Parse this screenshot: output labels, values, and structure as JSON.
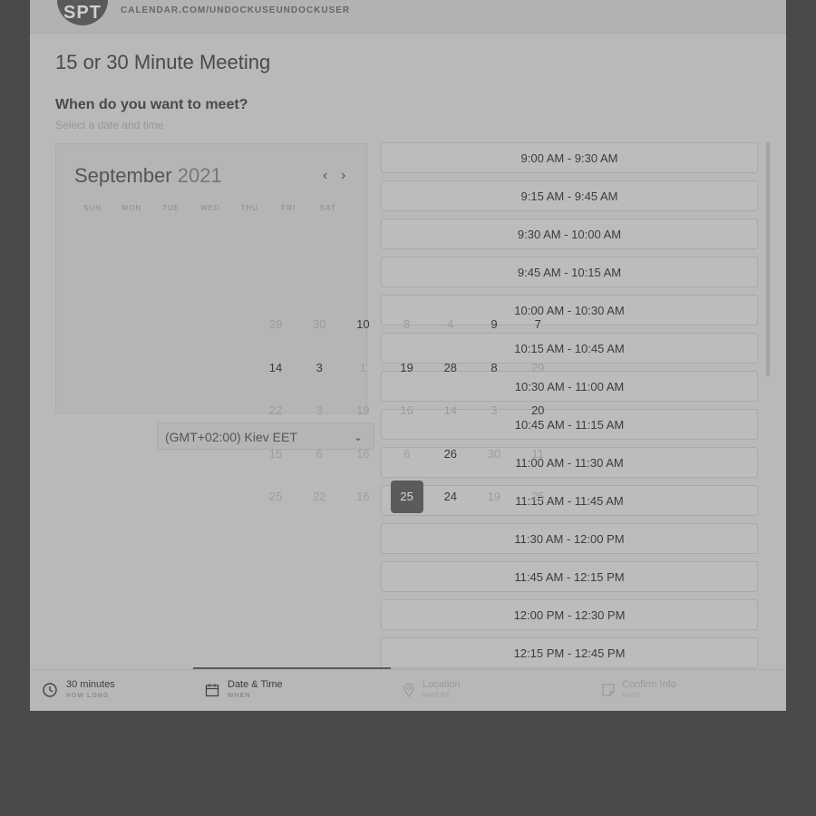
{
  "header": {
    "avatar_initials": "SPT",
    "url": "CALENDAR.COM/UNDOCKUSEUNDOCKUSER"
  },
  "meeting_title": "15 or 30 Minute Meeting",
  "prompt": {
    "title": "When do you want to meet?",
    "hint": "Select a date and time"
  },
  "calendar": {
    "month": "September",
    "year": "2021",
    "prev_icon": "‹",
    "next_icon": "›",
    "weekdays": [
      "SUN",
      "MON",
      "TUE",
      "WED",
      "THU",
      "FRI",
      "SAT"
    ],
    "selected_date": "25",
    "day_cells": [
      {
        "label": "29",
        "faint": true
      },
      {
        "label": "30",
        "faint": true
      },
      {
        "label": "10",
        "faint": false
      },
      {
        "label": "8",
        "faint": true
      },
      {
        "label": "4",
        "faint": true
      },
      {
        "label": "9",
        "faint": false
      },
      {
        "label": "7",
        "faint": false
      },
      {
        "label": "14",
        "faint": false
      },
      {
        "label": "3",
        "faint": false
      },
      {
        "label": "1",
        "faint": true
      },
      {
        "label": "19",
        "faint": false
      },
      {
        "label": "28",
        "faint": false
      },
      {
        "label": "8",
        "faint": false
      },
      {
        "label": "29",
        "faint": true
      },
      {
        "label": "22",
        "faint": true
      },
      {
        "label": "3",
        "faint": true
      },
      {
        "label": "19",
        "faint": true
      },
      {
        "label": "16",
        "faint": true
      },
      {
        "label": "14",
        "faint": true
      },
      {
        "label": "3",
        "faint": true
      },
      {
        "label": "20",
        "faint": false
      },
      {
        "label": "15",
        "faint": true
      },
      {
        "label": "6",
        "faint": true
      },
      {
        "label": "16",
        "faint": true
      },
      {
        "label": "6",
        "faint": true
      },
      {
        "label": "26",
        "faint": false
      },
      {
        "label": "30",
        "faint": true
      },
      {
        "label": "11",
        "faint": true
      },
      {
        "label": "25",
        "faint": true
      },
      {
        "label": "22",
        "faint": true
      },
      {
        "label": "16",
        "faint": true
      },
      {
        "label": "25",
        "faint": false,
        "selected": true
      },
      {
        "label": "24",
        "faint": false
      },
      {
        "label": "19",
        "faint": true
      },
      {
        "label": "25",
        "faint": true
      }
    ]
  },
  "timezone": {
    "label": "(GMT+02:00) Kiev EET",
    "chevron_icon": "⌄"
  },
  "time_slots": [
    "9:00 AM - 9:30 AM",
    "9:15 AM - 9:45 AM",
    "9:30 AM - 10:00 AM",
    "9:45 AM - 10:15 AM",
    "10:00 AM - 10:30 AM",
    "10:15 AM - 10:45 AM",
    "10:30 AM - 11:00 AM",
    "10:45 AM - 11:15 AM",
    "11:00 AM - 11:30 AM",
    "11:15 AM - 11:45 AM",
    "11:30 AM - 12:00 PM",
    "11:45 AM - 12:15 PM",
    "12:00 PM - 12:30 PM",
    "12:15 PM - 12:45 PM"
  ],
  "footer": {
    "steps": [
      {
        "title": "30 minutes",
        "sub": "HOW LONG",
        "icon": "clock-icon"
      },
      {
        "title": "Date & Time",
        "sub": "WHEN",
        "icon": "calendar-icon"
      },
      {
        "title": "Location",
        "sub": "WHERE",
        "icon": "map-pin-icon"
      },
      {
        "title": "Confirm Info",
        "sub": "WHO",
        "icon": "note-icon"
      }
    ]
  },
  "colors": {
    "backdrop": "#4a4a4a",
    "panel": "#b9b9b9",
    "selected": "#5b5b5b"
  }
}
